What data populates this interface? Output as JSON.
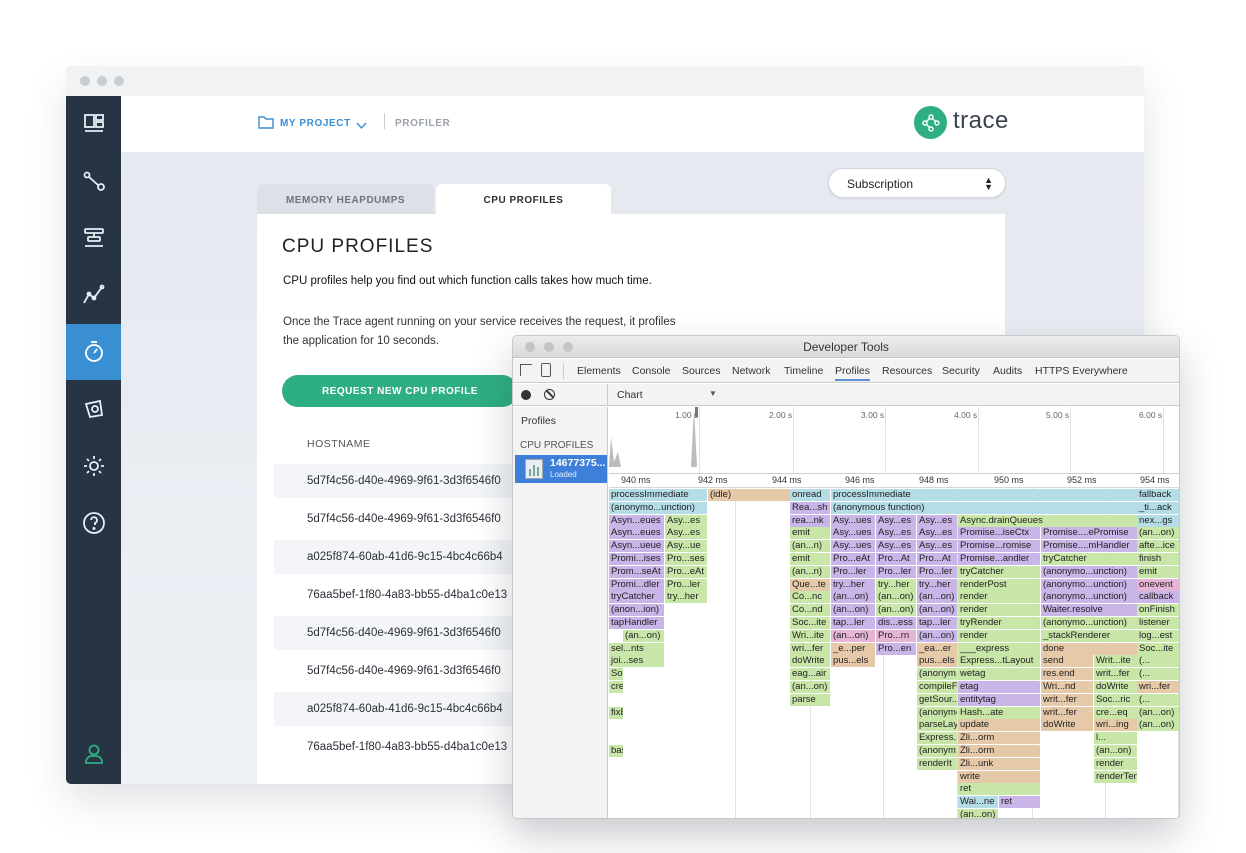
{
  "colors": {
    "brand_green": "#2eaf82",
    "accent_blue": "#3a8fd3",
    "sidebar": "#273444"
  },
  "sidebar": {
    "icons": [
      "dashboard-icon",
      "distributed-tracing-icon",
      "alerting-icon",
      "metrics-icon",
      "profiler-icon",
      "notification-icon",
      "settings-icon",
      "help-icon"
    ],
    "user_icon": "user-icon"
  },
  "header": {
    "project": "MY PROJECT",
    "section": "PROFILER",
    "logo_text": "trace"
  },
  "select": {
    "value": "Subscription"
  },
  "tabs": {
    "memory": "MEMORY HEAPDUMPS",
    "cpu": "CPU PROFILES"
  },
  "main": {
    "title": "CPU PROFILES",
    "lead": "CPU profiles help you find out which function calls takes how much time.",
    "description": "Once the Trace agent running on your service receives the request, it profiles the application for 10 seconds.",
    "request_button": "REQUEST NEW CPU PROFILE",
    "column": "HOSTNAME",
    "hosts": [
      "5d7f4c56-d40e-4969-9f61-3d3f6546f0",
      "5d7f4c56-d40e-4969-9f61-3d3f6546f0",
      "a025f874-60ab-41d6-9c15-4bc4c66b4",
      "76aa5bef-1f80-4a83-bb55-d4ba1c0e13",
      "5d7f4c56-d40e-4969-9f61-3d3f6546f0",
      "5d7f4c56-d40e-4969-9f61-3d3f6546f0",
      "a025f874-60ab-41d6-9c15-4bc4c66b4",
      "76aa5bef-1f80-4a83-bb55-d4ba1c0e13"
    ]
  },
  "devtools": {
    "title": "Developer Tools",
    "tabs": [
      "Elements",
      "Console",
      "Sources",
      "Network",
      "Timeline",
      "Profiles",
      "Resources",
      "Security",
      "Audits",
      "HTTPS Everywhere"
    ],
    "active_tab": "Profiles",
    "view_select": "Chart",
    "sidebar_profiles": "Profiles",
    "sidebar_cpu": "CPU PROFILES",
    "profile_name": "14677375...",
    "profile_status": "Loaded",
    "overview_ticks": [
      "1.00 s",
      "2.00 s",
      "3.00 s",
      "4.00 s",
      "5.00 s",
      "6.00 s"
    ],
    "ruler_ticks": [
      "940 ms",
      "942 ms",
      "944 ms",
      "946 ms",
      "948 ms",
      "950 ms",
      "952 ms",
      "954 ms"
    ],
    "frames": [
      {
        "t": "processImmediate",
        "c": "#b5dde8"
      },
      {
        "t": "(idle)",
        "c": "#e6c9a8"
      },
      {
        "t": "onread",
        "c": "#b5dde8"
      },
      {
        "t": "processImmediate",
        "c": "#b5dde8"
      },
      {
        "t": "fallback",
        "c": "#b5dde8"
      },
      {
        "t": "(anonymo...unction)",
        "c": "#b5dde8"
      },
      {
        "t": "Rea...sh",
        "c": "#c9b5e8"
      },
      {
        "t": "(anonymous function)",
        "c": "#b5dde8"
      },
      {
        "t": "_ti...ack",
        "c": "#b5dde8"
      },
      {
        "t": "Asyn...eues",
        "c": "#c9b5e8"
      },
      {
        "t": "Asy...es",
        "c": "#c8e6a8"
      },
      {
        "t": "rea...nk",
        "c": "#c9b5e8"
      },
      {
        "t": "Asy...ues",
        "c": "#c9b5e8"
      },
      {
        "t": "Asy...es",
        "c": "#c9b5e8"
      },
      {
        "t": "Asy...es",
        "c": "#c9b5e8"
      },
      {
        "t": "Async.drainQueues",
        "c": "#c8e6a8"
      },
      {
        "t": "nex...gs",
        "c": "#b5dde8"
      },
      {
        "t": "Asyn...eues",
        "c": "#c9b5e8"
      },
      {
        "t": "Asy...es",
        "c": "#c8e6a8"
      },
      {
        "t": "emit",
        "c": "#c8e6a8"
      },
      {
        "t": "Asy...ues",
        "c": "#c9b5e8"
      },
      {
        "t": "Asy...es",
        "c": "#c9b5e8"
      },
      {
        "t": "Asy...es",
        "c": "#c9b5e8"
      },
      {
        "t": "Promise...iseCtx",
        "c": "#c9b5e8"
      },
      {
        "t": "Promise....ePromise",
        "c": "#c9b5e8"
      },
      {
        "t": "(an...on)",
        "c": "#c8e6a8"
      },
      {
        "t": "Asyn...ueue",
        "c": "#c9b5e8"
      },
      {
        "t": "Asy...ue",
        "c": "#c8e6a8"
      },
      {
        "t": "(an...n)",
        "c": "#c8e6a8"
      },
      {
        "t": "Asy...ues",
        "c": "#c9b5e8"
      },
      {
        "t": "Asy...es",
        "c": "#c9b5e8"
      },
      {
        "t": "Asy...es",
        "c": "#c9b5e8"
      },
      {
        "t": "Promise...romise",
        "c": "#c9b5e8"
      },
      {
        "t": "Promise....mHandler",
        "c": "#c9b5e8"
      },
      {
        "t": "afte...ice",
        "c": "#c8e6a8"
      },
      {
        "t": "Promi...ises",
        "c": "#c9b5e8"
      },
      {
        "t": "Pro...ses",
        "c": "#c8e6a8"
      },
      {
        "t": "emit",
        "c": "#c8e6a8"
      },
      {
        "t": "Pro...eAt",
        "c": "#c9b5e8"
      },
      {
        "t": "Pro...At",
        "c": "#c9b5e8"
      },
      {
        "t": "Pro...At",
        "c": "#c9b5e8"
      },
      {
        "t": "Promise...andler",
        "c": "#c9b5e8"
      },
      {
        "t": "tryCatcher",
        "c": "#c8e6a8"
      },
      {
        "t": "finish",
        "c": "#c8e6a8"
      },
      {
        "t": "Prom...seAt",
        "c": "#c9b5e8"
      },
      {
        "t": "Pro...eAt",
        "c": "#c8e6a8"
      },
      {
        "t": "(an...n)",
        "c": "#c8e6a8"
      },
      {
        "t": "Pro...ler",
        "c": "#c9b5e8"
      },
      {
        "t": "Pro...ler",
        "c": "#c9b5e8"
      },
      {
        "t": "Pro...ler",
        "c": "#c9b5e8"
      },
      {
        "t": "tryCatcher",
        "c": "#c8e6a8"
      },
      {
        "t": "(anonymo...unction)",
        "c": "#c9b5e8"
      },
      {
        "t": "emit",
        "c": "#c8e6a8"
      },
      {
        "t": "Promi...dler",
        "c": "#c9b5e8"
      },
      {
        "t": "Pro...ler",
        "c": "#c8e6a8"
      },
      {
        "t": "Que...te",
        "c": "#e6c9a8"
      },
      {
        "t": "try...her",
        "c": "#c9b5e8"
      },
      {
        "t": "try...her",
        "c": "#c8e6a8"
      },
      {
        "t": "try...her",
        "c": "#c9b5e8"
      },
      {
        "t": "renderPost",
        "c": "#c8e6a8"
      },
      {
        "t": "(anonymo...unction)",
        "c": "#c9b5e8"
      },
      {
        "t": "onevent",
        "c": "#e6b5d5"
      },
      {
        "t": "tryCatcher",
        "c": "#c9b5e8"
      },
      {
        "t": "try...her",
        "c": "#c8e6a8"
      },
      {
        "t": "Co...nc",
        "c": "#c8e6a8"
      },
      {
        "t": "(an...on)",
        "c": "#c9b5e8"
      },
      {
        "t": "(an...on)",
        "c": "#c8e6a8"
      },
      {
        "t": "(an...on)",
        "c": "#c9b5e8"
      },
      {
        "t": "render",
        "c": "#c8e6a8"
      },
      {
        "t": "(anonymo...unction)",
        "c": "#c9b5e8"
      },
      {
        "t": "callback",
        "c": "#c9b5e8"
      },
      {
        "t": "(anon...ion)",
        "c": "#c9b5e8"
      },
      {
        "t": "Co...nd",
        "c": "#c8e6a8"
      },
      {
        "t": "(an...on)",
        "c": "#c9b5e8"
      },
      {
        "t": "(an...on)",
        "c": "#c8e6a8"
      },
      {
        "t": "(an...on)",
        "c": "#c9b5e8"
      },
      {
        "t": "render",
        "c": "#c8e6a8"
      },
      {
        "t": "Waiter.resolve",
        "c": "#c9b5e8"
      },
      {
        "t": "onFinish",
        "c": "#c8e6a8"
      },
      {
        "t": "tapHandler",
        "c": "#c9b5e8"
      },
      {
        "t": "Soc...ite",
        "c": "#c8e6a8"
      },
      {
        "t": "tap...ler",
        "c": "#c9b5e8"
      },
      {
        "t": "dis...ess",
        "c": "#c9b5e8"
      },
      {
        "t": "tap...ler",
        "c": "#c9b5e8"
      },
      {
        "t": "tryRender",
        "c": "#c8e6a8"
      },
      {
        "t": "(anonymo...unction)",
        "c": "#c8e6a8"
      },
      {
        "t": "listener",
        "c": "#c8e6a8"
      },
      {
        "t": "(an...on)",
        "c": "#c8e6a8"
      },
      {
        "t": "Wri...ite",
        "c": "#c8e6a8"
      },
      {
        "t": "(an...on)",
        "c": "#e6b5d5"
      },
      {
        "t": "Pro...rn",
        "c": "#e6b5d5"
      },
      {
        "t": "(an...on)",
        "c": "#c9b5e8"
      },
      {
        "t": "render",
        "c": "#c8e6a8"
      },
      {
        "t": "_stackRenderer",
        "c": "#c8e6a8"
      },
      {
        "t": "log...est",
        "c": "#c8e6a8"
      },
      {
        "t": "sel...nts",
        "c": "#c8e6a8"
      },
      {
        "t": "wri...fer",
        "c": "#c8e6a8"
      },
      {
        "t": "_e...per",
        "c": "#e6c9a8"
      },
      {
        "t": "Pro...en",
        "c": "#c9b5e8"
      },
      {
        "t": "_ea...er",
        "c": "#e6c9a8"
      },
      {
        "t": "___express",
        "c": "#c8e6a8"
      },
      {
        "t": "done",
        "c": "#e6c9a8"
      },
      {
        "t": "Soc...ite",
        "c": "#c8e6a8"
      },
      {
        "t": "joi...ses",
        "c": "#c8e6a8"
      },
      {
        "t": "doWrite",
        "c": "#c8e6a8"
      },
      {
        "t": "pus...els",
        "c": "#e6c9a8"
      },
      {
        "t": "pus...els",
        "c": "#e6c9a8"
      },
      {
        "t": "Express...tLayout",
        "c": "#c8e6a8"
      },
      {
        "t": "send",
        "c": "#e6c9a8"
      },
      {
        "t": "Writ...ite",
        "c": "#c8e6a8"
      },
      {
        "t": "(...",
        "c": "#c8e6a8"
      },
      {
        "t": "Soc...ric",
        "c": "#c8e6a8"
      },
      {
        "t": "eag...air",
        "c": "#c8e6a8"
      },
      {
        "t": "(anonym...function)",
        "c": "#c8e6a8"
      },
      {
        "t": "wetag",
        "c": "#c8e6a8"
      },
      {
        "t": "res.end",
        "c": "#e6c9a8"
      },
      {
        "t": "writ...fer",
        "c": "#c8e6a8"
      },
      {
        "t": "(...",
        "c": "#c8e6a8"
      },
      {
        "t": "cre...eq",
        "c": "#c8e6a8"
      },
      {
        "t": "(an...on)",
        "c": "#c8e6a8"
      },
      {
        "t": "compileFile",
        "c": "#c8e6a8"
      },
      {
        "t": "etag",
        "c": "#c9b5e8"
      },
      {
        "t": "Wri...nd",
        "c": "#e6c9a8"
      },
      {
        "t": "doWrite",
        "c": "#c8e6a8"
      },
      {
        "t": "wri...fer",
        "c": "#e6c9a8"
      },
      {
        "t": "parse",
        "c": "#c8e6a8"
      },
      {
        "t": "getSour...mplate",
        "c": "#c8e6a8"
      },
      {
        "t": "entitytag",
        "c": "#c9b5e8"
      },
      {
        "t": "writ...fer",
        "c": "#e6c9a8"
      },
      {
        "t": "Soc...ric",
        "c": "#c8e6a8"
      },
      {
        "t": "(...",
        "c": "#c8e6a8"
      },
      {
        "t": "fixBools",
        "c": "#c8e6a8"
      },
      {
        "t": "(anonymo...nction)",
        "c": "#c8e6a8"
      },
      {
        "t": "Hash...ate",
        "c": "#c8e6a8"
      },
      {
        "t": "writ...fer",
        "c": "#e6c9a8"
      },
      {
        "t": "cre...eq",
        "c": "#c8e6a8"
      },
      {
        "t": "(an...on)",
        "c": "#c8e6a8"
      },
      {
        "t": "parseLayout",
        "c": "#c8e6a8"
      },
      {
        "t": "update",
        "c": "#e6c9a8"
      },
      {
        "t": "doWrite",
        "c": "#e6c9a8"
      },
      {
        "t": "wri...ing",
        "c": "#e6c9a8"
      },
      {
        "t": "(an...on)",
        "c": "#c8e6a8"
      },
      {
        "t": "Express...eLayout",
        "c": "#c8e6a8"
      },
      {
        "t": "Zli...orm",
        "c": "#e6c9a8"
      },
      {
        "t": "l...",
        "c": "#c8e6a8"
      },
      {
        "t": "bas...wn",
        "c": "#c8e6a8"
      },
      {
        "t": "(anonym...nction)",
        "c": "#c8e6a8"
      },
      {
        "t": "Zli...orm",
        "c": "#e6c9a8"
      },
      {
        "t": "(an...on)",
        "c": "#c8e6a8"
      },
      {
        "t": "renderIt",
        "c": "#c8e6a8"
      },
      {
        "t": "Zli...unk",
        "c": "#e6c9a8"
      },
      {
        "t": "render",
        "c": "#c8e6a8"
      },
      {
        "t": "write",
        "c": "#e6c9a8"
      },
      {
        "t": "renderTemplate",
        "c": "#c8e6a8"
      },
      {
        "t": "ret",
        "c": "#c8e6a8"
      },
      {
        "t": "Wai...ne",
        "c": "#b5dde8"
      },
      {
        "t": "ret",
        "c": "#c9b5e8"
      },
      {
        "t": "(an...on)",
        "c": "#c8e6a8"
      }
    ]
  }
}
